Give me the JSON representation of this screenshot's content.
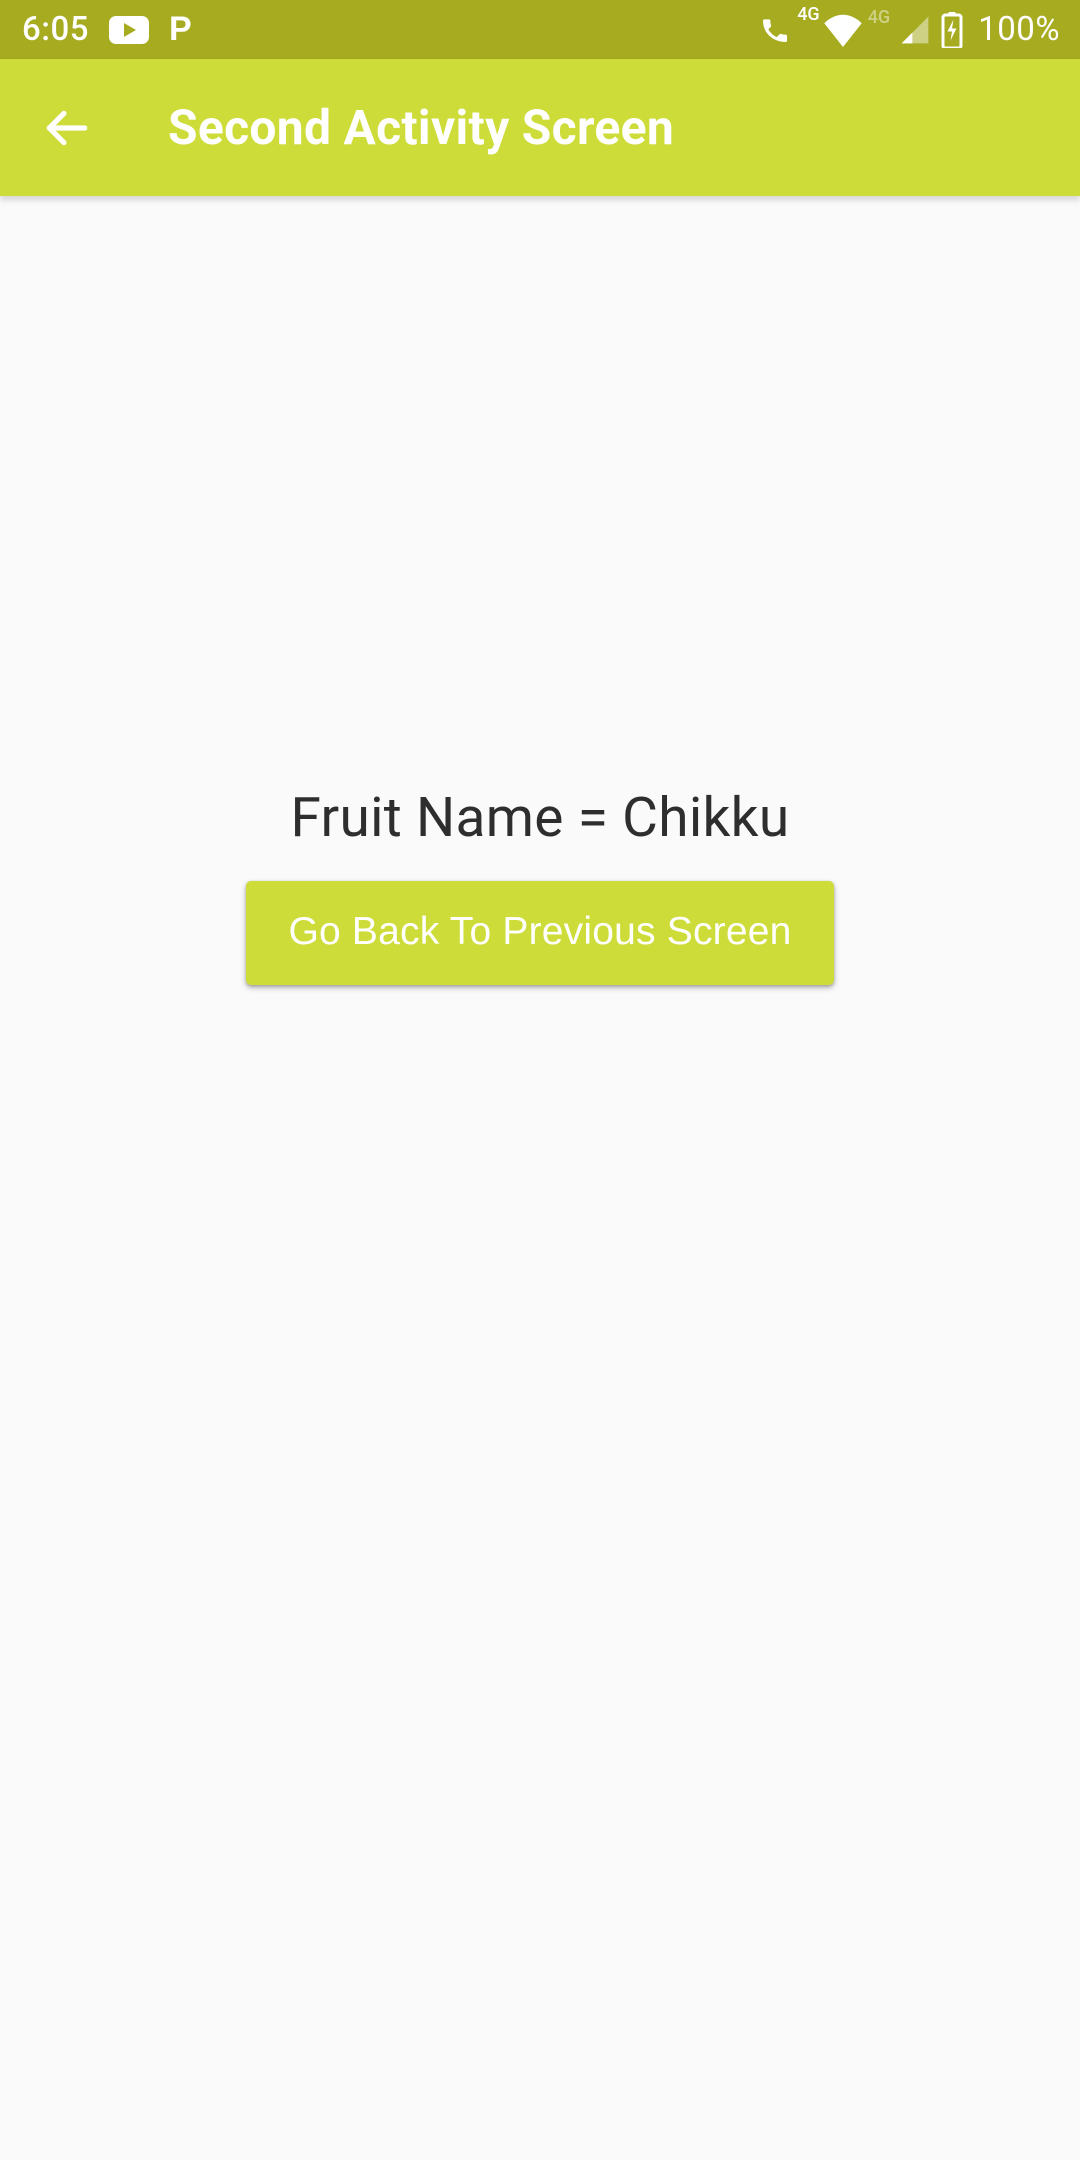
{
  "statusBar": {
    "time": "6:05",
    "fourG1": "4G",
    "fourG2": "4G",
    "batteryPct": "100%"
  },
  "appBar": {
    "title": "Second Activity Screen"
  },
  "content": {
    "fruitLabel": "Fruit Name = Chikku",
    "goBackLabel": "Go Back To Previous Screen"
  },
  "colors": {
    "statusBar": "#a6ab1f",
    "appBar": "#cddc39",
    "button": "#cddc39",
    "background": "#fafafa"
  }
}
